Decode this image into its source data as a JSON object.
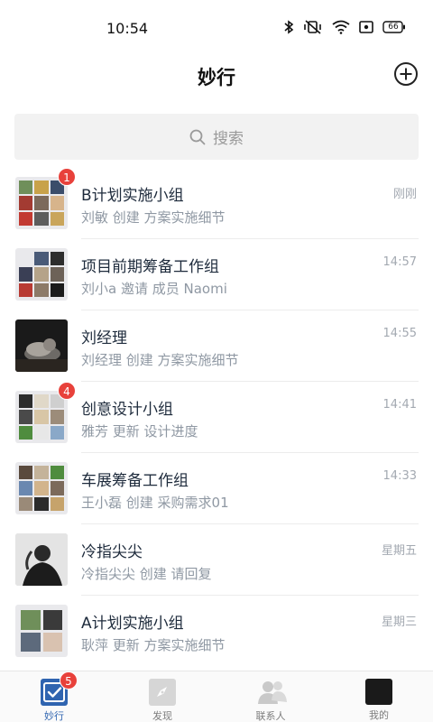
{
  "status_bar": {
    "time": "10:54",
    "battery": "66",
    "icons": [
      "bluetooth-icon",
      "mute-vibrate-icon",
      "wifi-icon",
      "screen-record-icon",
      "battery-icon"
    ]
  },
  "header": {
    "title": "妙行",
    "add_icon": "plus-circle-icon"
  },
  "search": {
    "placeholder": "搜索",
    "icon": "search-icon"
  },
  "conversations": [
    {
      "name": "B计划实施小组",
      "preview": "刘敏 创建 方案实施细节",
      "time": "刚刚",
      "badge": "1",
      "avatar": "group-grid-9"
    },
    {
      "name": "项目前期筹备工作组",
      "preview": "刘小a 邀请 成员 Naomi",
      "time": "14:57",
      "badge": "",
      "avatar": "group-grid-6"
    },
    {
      "name": "刘经理",
      "preview": "刘经理 创建 方案实施细节",
      "time": "14:55",
      "badge": "",
      "avatar": "photo-cat"
    },
    {
      "name": "创意设计小组",
      "preview": "雅芳 更新 设计进度",
      "time": "14:41",
      "badge": "4",
      "avatar": "group-grid-9"
    },
    {
      "name": "车展筹备工作组",
      "preview": "王小磊 创建 采购需求01",
      "time": "14:33",
      "badge": "",
      "avatar": "group-grid-9"
    },
    {
      "name": "冷指尖尖",
      "preview": "冷指尖尖 创建 请回复",
      "time": "星期五",
      "badge": "",
      "avatar": "photo-person"
    },
    {
      "name": "A计划实施小组",
      "preview": "耿萍 更新 方案实施细节",
      "time": "星期三",
      "badge": "",
      "avatar": "group-grid-4"
    }
  ],
  "tabbar": {
    "tabs": [
      {
        "label": "妙行",
        "icon": "check-square-icon",
        "badge": "5",
        "active": true
      },
      {
        "label": "发现",
        "icon": "compass-icon",
        "badge": "",
        "active": false
      },
      {
        "label": "联系人",
        "icon": "contacts-icon",
        "badge": "",
        "active": false
      },
      {
        "label": "我的",
        "icon": "profile-avatar-icon",
        "badge": "",
        "active": false
      }
    ]
  },
  "colors": {
    "accent": "#2f64b0",
    "badge": "#e8413b",
    "title_text": "#1e2b3c",
    "sub_text": "#8f98a3",
    "time_text": "#a3a9b1"
  }
}
